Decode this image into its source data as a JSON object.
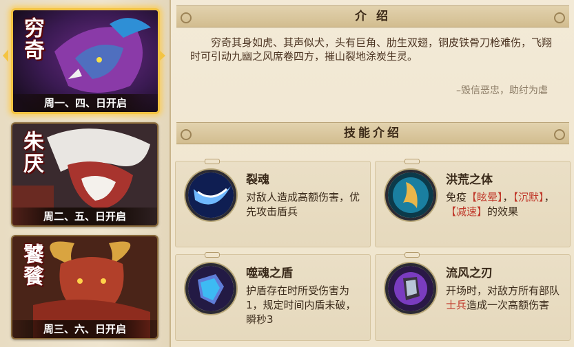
{
  "heroes": [
    {
      "name": "穷奇",
      "days": "周一、四、日开启",
      "selected": true
    },
    {
      "name": "朱厌",
      "days": "周二、五、日开启",
      "selected": false
    },
    {
      "name": "饕餮",
      "days": "周三、六、日开启",
      "selected": false
    }
  ],
  "intro": {
    "header": "介 绍",
    "text": "穷奇其身如虎、其声似犬，头有巨角、肋生双翅，铜皮铁骨刀枪难伤，飞翔时可引动九幽之风席卷四方，摧山裂地涂炭生灵。",
    "quote": "–毁信恶忠，助纣为虐"
  },
  "skills_header": "技能介绍",
  "skills": [
    {
      "name": "裂魂",
      "desc": "对敌人造成高额伤害，优先攻击盾兵"
    },
    {
      "name": "洪荒之体",
      "desc_prefix": "免疫",
      "kw1": "【眩晕】",
      "sep1": "，",
      "kw2": "【沉默】",
      "sep2": "，",
      "kw3": "【减速】",
      "desc_suffix": "的效果"
    },
    {
      "name": "噬魂之盾",
      "desc": "护盾存在时所受伤害为1，规定时间内盾未破，瞬秒3"
    },
    {
      "name": "流风之刃",
      "desc_prefix": "开场时，对敌方所有部队",
      "kw1": "士兵",
      "desc_suffix": "造成一次高额伤害"
    }
  ],
  "colors": {
    "accent": "#f3c443",
    "keyword": "#c0392b",
    "text": "#3a2a1a"
  }
}
